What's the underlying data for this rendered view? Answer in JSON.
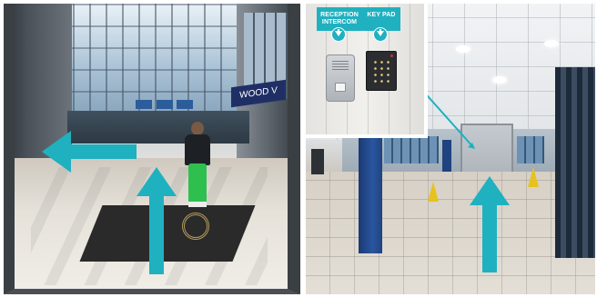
{
  "inset": {
    "reception_label": "RECEPTION INTERCOM",
    "keypad_label": "KEY PAD"
  },
  "left_photo": {
    "sign_text": "WOOD V"
  },
  "colors": {
    "arrow": "#1fb1c0",
    "label_bg": "#1fb1c0",
    "pillar": "#2a56a0"
  },
  "icons": {
    "reception_marker": "arrow-down-circle-icon",
    "keypad_marker": "arrow-down-circle-icon",
    "arrows": [
      "arrow-left-icon",
      "arrow-up-icon",
      "arrow-up-icon",
      "pointer-line-icon"
    ]
  }
}
